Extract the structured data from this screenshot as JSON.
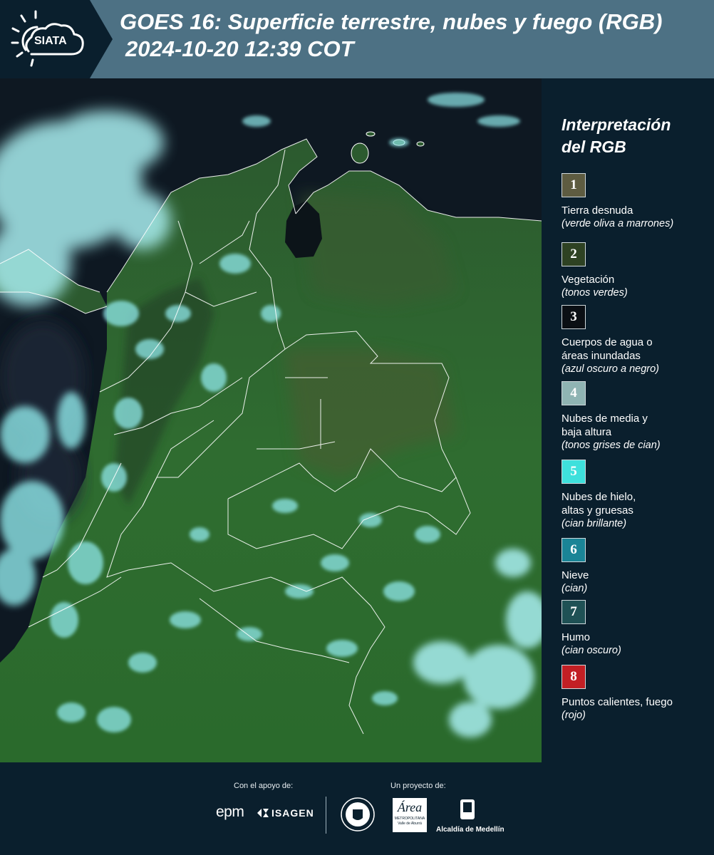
{
  "header": {
    "logo_text": "SIATA",
    "title_line1": "GOES 16: Superficie terrestre, nubes y fuego (RGB)",
    "title_line2": "2024-10-20 12:39 COT"
  },
  "legend": {
    "title_line1": "Interpretación",
    "title_line2": "del RGB",
    "items": [
      {
        "num": "1",
        "color": "#5e5c41",
        "label": "Tierra desnuda",
        "hint": "(verde oliva a marrones)"
      },
      {
        "num": "2",
        "color": "#2e4223",
        "label": "Vegetación",
        "hint": "(tonos verdes)"
      },
      {
        "num": "3",
        "color": "#0b0f14",
        "label": "Cuerpos de agua o\náreas inundadas",
        "hint": "(azul oscuro a negro)"
      },
      {
        "num": "4",
        "color": "#8fb4b3",
        "label": "Nubes de media y\nbaja altura",
        "hint": "(tonos grises de cian)"
      },
      {
        "num": "5",
        "color": "#3ee0dc",
        "label": "Nubes de hielo,\naltas y gruesas",
        "hint": "(cian brillante)"
      },
      {
        "num": "6",
        "color": "#1a8496",
        "label": "Nieve",
        "hint": "(cian)"
      },
      {
        "num": "7",
        "color": "#1f5155",
        "label": "Humo",
        "hint": "(cian oscuro)"
      },
      {
        "num": "8",
        "color": "#c21f24",
        "label": "Puntos calientes, fuego",
        "hint": "(rojo)"
      }
    ]
  },
  "footer": {
    "support_label": "Con el apoyo de:",
    "project_label": "Un proyecto de:",
    "sponsor_epm": "epm",
    "sponsor_isagen": "ISAGEN",
    "sponsor_area": "Área",
    "sponsor_area_sub": "METROPOLITANA",
    "sponsor_area_sub2": "Valle de Aburrá",
    "sponsor_alcaldia": "Alcaldía de Medellín"
  },
  "colors": {
    "header_bg": "#4d7184",
    "page_bg": "#0a1f2d",
    "vegetation": "#2f6a2e",
    "cloud": "#7fe6e6",
    "ocean": "#0d1620"
  }
}
